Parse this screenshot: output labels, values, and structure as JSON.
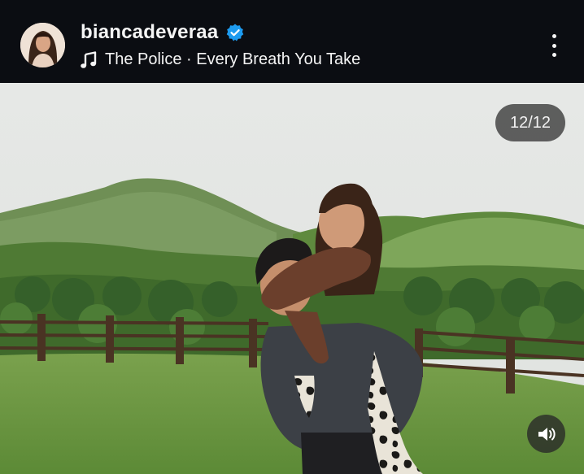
{
  "post": {
    "username": "biancadeveraa",
    "music": "The Police · Every Breath You Take",
    "counter": "12/12"
  },
  "colors": {
    "header_bg": "#0b0d12",
    "verified_blue": "#1d9bf0",
    "sky": "#e8ebe8",
    "grass": "#6f9a45"
  },
  "icons": {
    "verified": "verified-badge-icon",
    "music": "music-note-icon",
    "more": "more-vertical-icon",
    "audio": "speaker-icon"
  }
}
